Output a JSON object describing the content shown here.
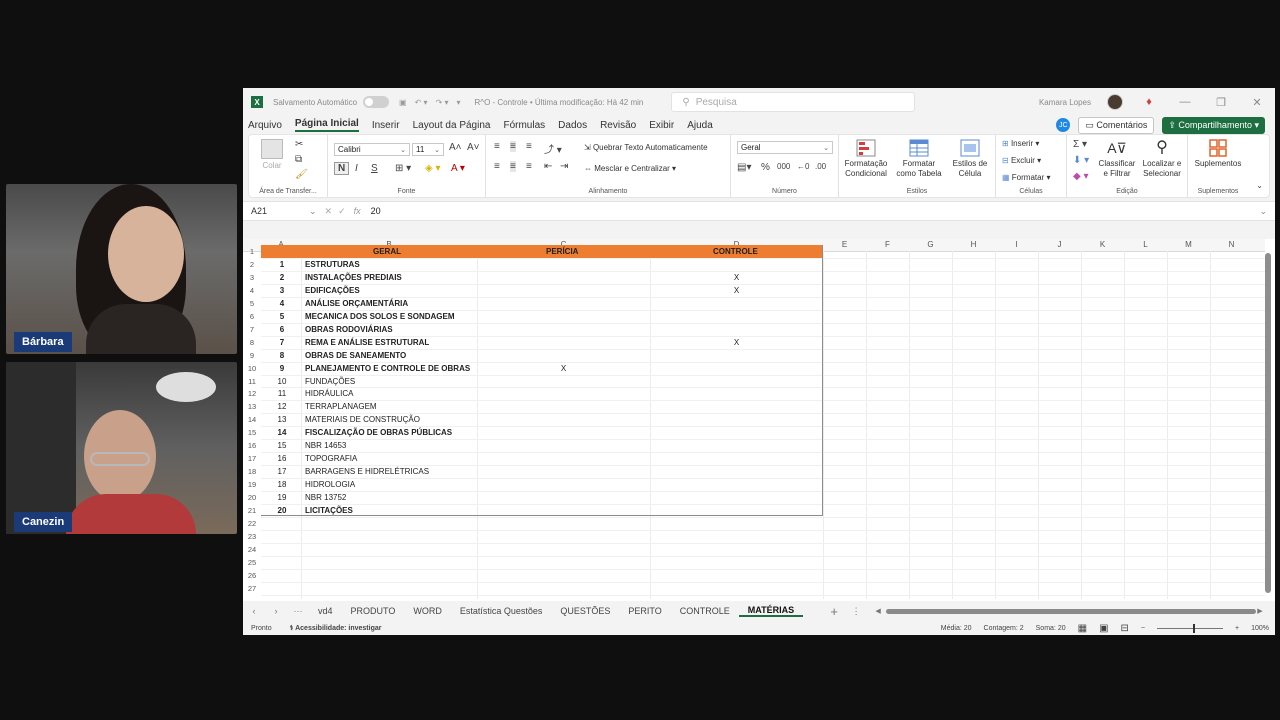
{
  "participants": [
    {
      "name": "Bárbara"
    },
    {
      "name": "Canezin"
    }
  ],
  "titlebar": {
    "autosave": "Salvamento Automático",
    "doc_title": "R^O - Controle • Última modificação: Há 42 min",
    "search_placeholder": "Pesquisa",
    "user": "Kamara Lopes"
  },
  "menu": {
    "tabs": [
      "Arquivo",
      "Página Inicial",
      "Inserir",
      "Layout da Página",
      "Fórmulas",
      "Dados",
      "Revisão",
      "Exibir",
      "Ajuda"
    ],
    "active": "Página Inicial",
    "copilot": "JC",
    "comments": "Comentários",
    "share": "Compartilhamento"
  },
  "ribbon": {
    "clipboard": {
      "paste": "Colar",
      "label": "Área de Transfer..."
    },
    "font": {
      "name": "Calibri",
      "size": "11",
      "label": "Fonte",
      "bold": "N",
      "italic": "I",
      "underline": "S"
    },
    "alignment": {
      "wrap": "Quebrar Texto Automaticamente",
      "merge": "Mesclar e Centralizar",
      "label": "Alinhamento"
    },
    "number": {
      "format": "Geral",
      "label": "Número"
    },
    "styles": {
      "cond": "Formatação Condicional",
      "table": "Formatar como Tabela",
      "cell": "Estilos de Célula",
      "label": "Estilos"
    },
    "cells": {
      "insert": "Inserir",
      "delete": "Excluir",
      "format": "Formatar",
      "label": "Células"
    },
    "editing": {
      "sort": "Classificar e Filtrar",
      "find": "Localizar e Selecionar",
      "label": "Edição"
    },
    "addins": {
      "btn": "Suplementos",
      "label": "Suplementos"
    }
  },
  "formula_bar": {
    "cell_ref": "A21",
    "fx": "fx",
    "value": "20"
  },
  "grid": {
    "columns": [
      "A",
      "B",
      "C",
      "D",
      "E",
      "F",
      "G",
      "H",
      "I",
      "J",
      "K",
      "L",
      "M",
      "N"
    ],
    "header": {
      "b": "GERAL",
      "c": "PERÍCIA",
      "d": "CONTROLE"
    },
    "rows": [
      {
        "n": "1",
        "name": "ESTRUTURAS",
        "bold": true,
        "c": "",
        "d": ""
      },
      {
        "n": "2",
        "name": "INSTALAÇÕES PREDIAIS",
        "bold": true,
        "c": "",
        "d": "X"
      },
      {
        "n": "3",
        "name": "EDIFICAÇÕES",
        "bold": true,
        "c": "",
        "d": "X"
      },
      {
        "n": "4",
        "name": "ANÁLISE ORÇAMENTÁRIA",
        "bold": true,
        "c": "",
        "d": ""
      },
      {
        "n": "5",
        "name": "MECANICA DOS SOLOS E SONDAGEM",
        "bold": true,
        "c": "",
        "d": ""
      },
      {
        "n": "6",
        "name": "OBRAS RODOVIÁRIAS",
        "bold": true,
        "c": "",
        "d": ""
      },
      {
        "n": "7",
        "name": "REMA E ANÁLISE ESTRUTURAL",
        "bold": true,
        "c": "",
        "d": "X"
      },
      {
        "n": "8",
        "name": "OBRAS DE SANEAMENTO",
        "bold": true,
        "c": "",
        "d": ""
      },
      {
        "n": "9",
        "name": "PLANEJAMENTO E CONTROLE DE OBRAS",
        "bold": true,
        "c": "X",
        "d": ""
      },
      {
        "n": "10",
        "name": "FUNDAÇÕES",
        "bold": false,
        "c": "",
        "d": ""
      },
      {
        "n": "11",
        "name": "HIDRÁULICA",
        "bold": false,
        "c": "",
        "d": ""
      },
      {
        "n": "12",
        "name": "TERRAPLANAGEM",
        "bold": false,
        "c": "",
        "d": ""
      },
      {
        "n": "13",
        "name": "MATERIAIS DE CONSTRUÇÃO",
        "bold": false,
        "c": "",
        "d": ""
      },
      {
        "n": "14",
        "name": "FISCALIZAÇÃO DE OBRAS PÚBLICAS",
        "bold": true,
        "c": "",
        "d": ""
      },
      {
        "n": "15",
        "name": "NBR 14653",
        "bold": false,
        "c": "",
        "d": ""
      },
      {
        "n": "16",
        "name": "TOPOGRAFIA",
        "bold": false,
        "c": "",
        "d": ""
      },
      {
        "n": "17",
        "name": "BARRAGENS E HIDRELÉTRICAS",
        "bold": false,
        "c": "",
        "d": ""
      },
      {
        "n": "18",
        "name": "HIDROLOGIA",
        "bold": false,
        "c": "",
        "d": ""
      },
      {
        "n": "19",
        "name": "NBR 13752",
        "bold": false,
        "c": "",
        "d": ""
      },
      {
        "n": "20",
        "name": "LICITAÇÕES",
        "bold": true,
        "c": "",
        "d": ""
      }
    ],
    "row_numbers": [
      "1",
      "2",
      "3",
      "4",
      "5",
      "6",
      "7",
      "8",
      "9",
      "10",
      "11",
      "12",
      "13",
      "14",
      "15",
      "16",
      "17",
      "18",
      "19",
      "20",
      "21",
      "22",
      "23",
      "24",
      "25",
      "26",
      "27"
    ]
  },
  "sheets": {
    "tabs": [
      "vd4",
      "PRODUTO",
      "WORD",
      "Estatística Questões",
      "QUESTÕES",
      "PERITO",
      "CONTROLE",
      "MATÉRIAS"
    ],
    "active": "MATÉRIAS"
  },
  "status": {
    "ready": "Pronto",
    "accessibility": "Acessibilidade: investigar",
    "average": "Média: 20",
    "count": "Contagem: 2",
    "sum": "Soma: 20",
    "zoom": "100%"
  },
  "colors": {
    "header_fill": "#ed7d31",
    "accent": "#1d6f42",
    "nameplate": "#1b3a78"
  }
}
